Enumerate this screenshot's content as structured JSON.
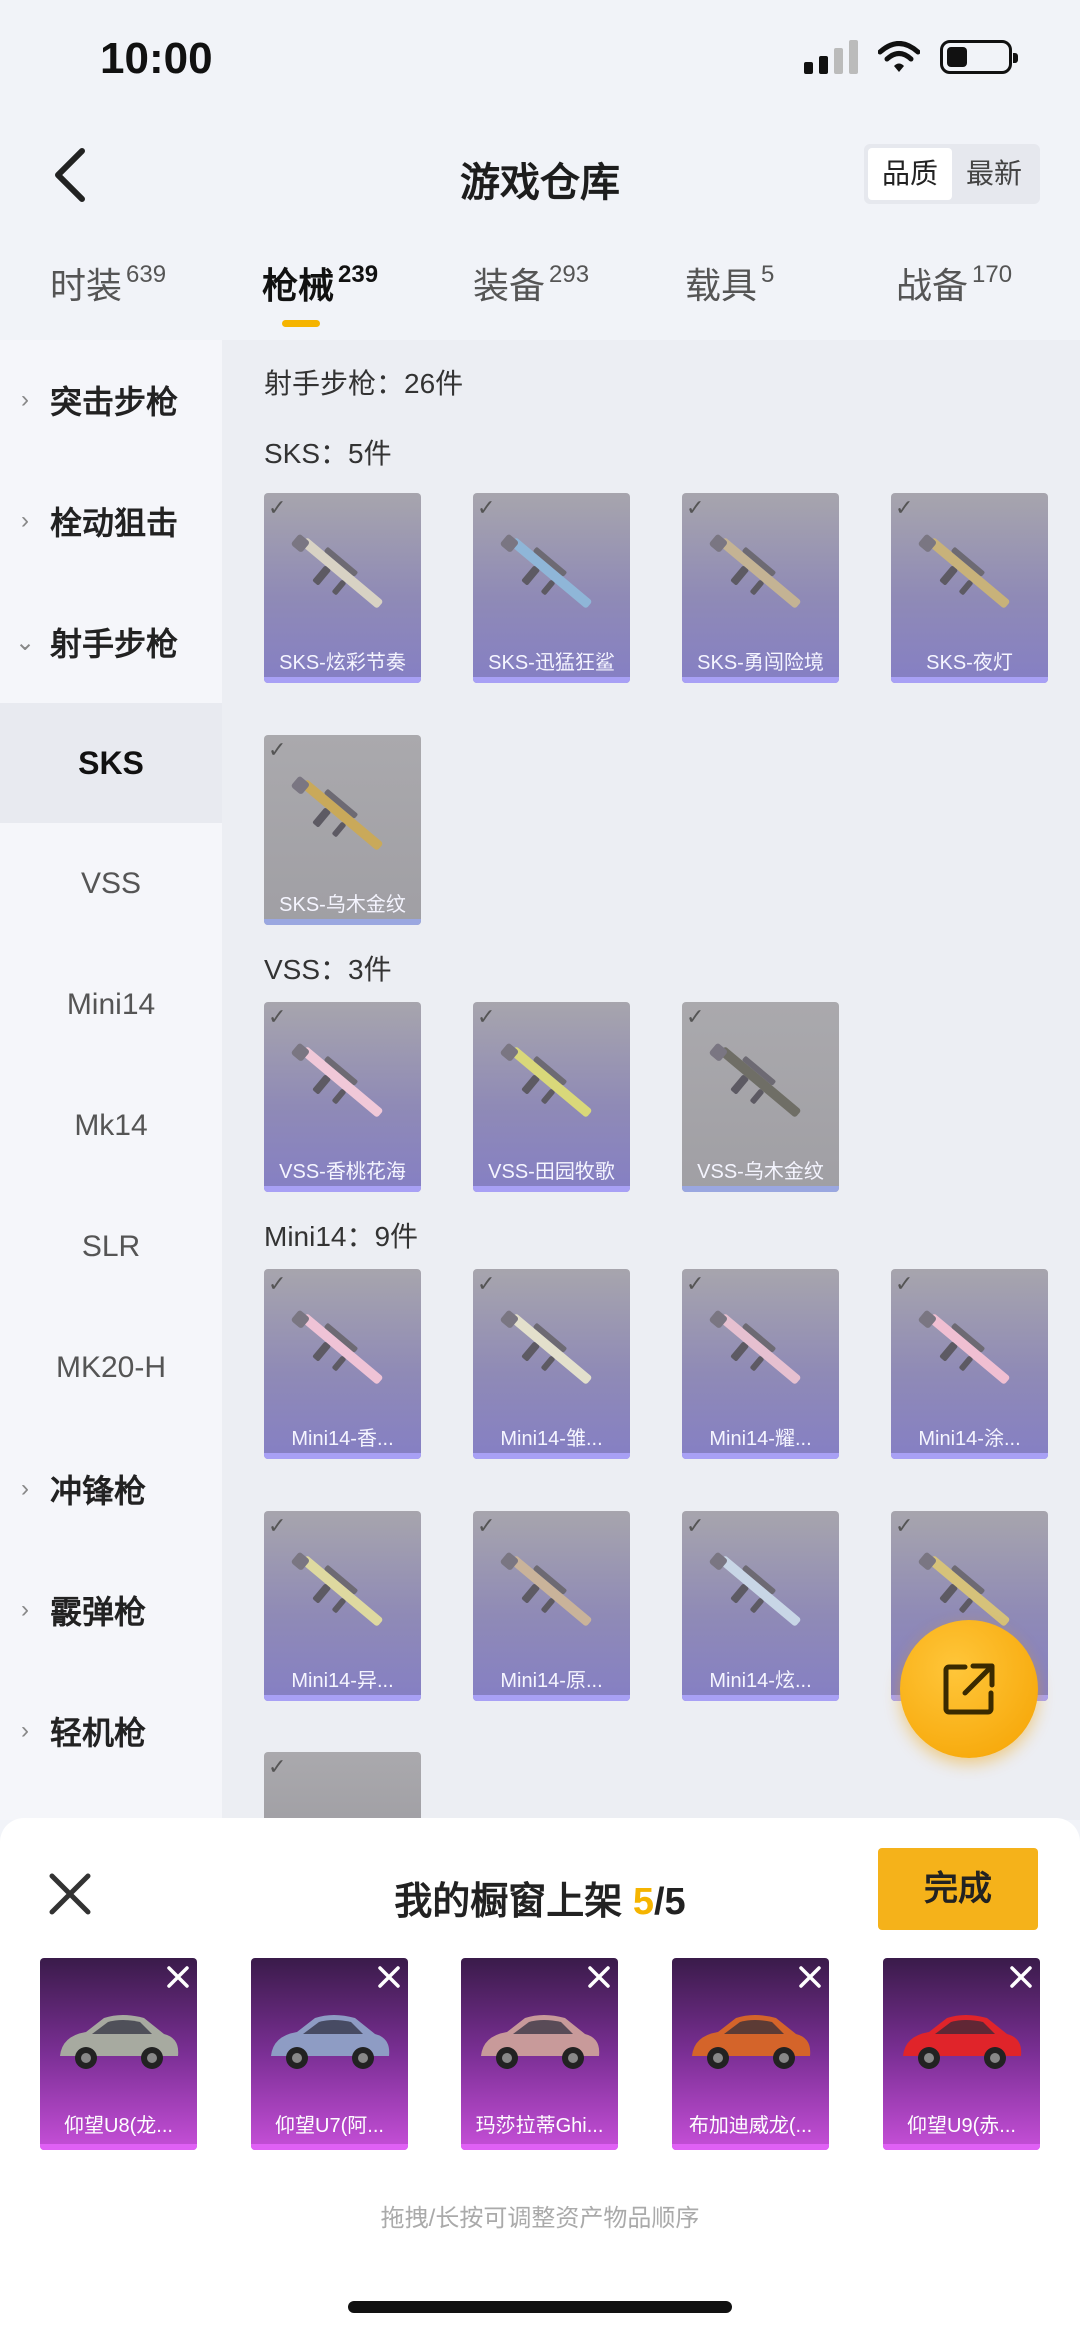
{
  "status": {
    "time": "10:00"
  },
  "header": {
    "title": "游戏仓库",
    "sort_options": [
      "品质",
      "最新"
    ]
  },
  "tabs": [
    {
      "label": "时装",
      "count": "639"
    },
    {
      "label": "枪械",
      "count": "239"
    },
    {
      "label": "装备",
      "count": "293"
    },
    {
      "label": "载具",
      "count": "5"
    },
    {
      "label": "战备",
      "count": "170"
    }
  ],
  "sidebar": {
    "categories": [
      "突击步枪",
      "栓动狙击",
      "射手步枪",
      "冲锋枪",
      "霰弹枪",
      "轻机枪"
    ],
    "subitems": [
      "SKS",
      "VSS",
      "Mini14",
      "Mk14",
      "SLR",
      "MK20-H"
    ]
  },
  "content": {
    "category_header": "射手步枪：26件",
    "sks_header": "SKS：5件",
    "vss_header": "VSS：3件",
    "mini14_header": "Mini14：9件",
    "sks_items": [
      "SKS-炫彩节奏",
      "SKS-迅猛狂鲨",
      "SKS-勇闯险境",
      "SKS-夜灯",
      "SKS-乌木金纹"
    ],
    "vss_items": [
      "VSS-香桃花海",
      "VSS-田园牧歌",
      "VSS-乌木金纹"
    ],
    "mini14_items": [
      "Mini14-香...",
      "Mini14-雏...",
      "Mini14-耀...",
      "Mini14-涂...",
      "Mini14-异...",
      "Mini14-原...",
      "Mini14-炫...",
      ""
    ]
  },
  "panel": {
    "title": "我的橱窗上架",
    "current": "5",
    "total": "/5",
    "done_label": "完成",
    "vehicles": [
      "仰望U8(龙...",
      "仰望U7(阿...",
      "玛莎拉蒂Ghi...",
      "布加迪威龙(...",
      "仰望U9(赤..."
    ],
    "hint": "拖拽/长按可调整资产物品顺序"
  },
  "colors": {
    "accent": "#f5b400",
    "card_purple": "#857fc4",
    "vehicle_purple": "#c64fd8"
  }
}
